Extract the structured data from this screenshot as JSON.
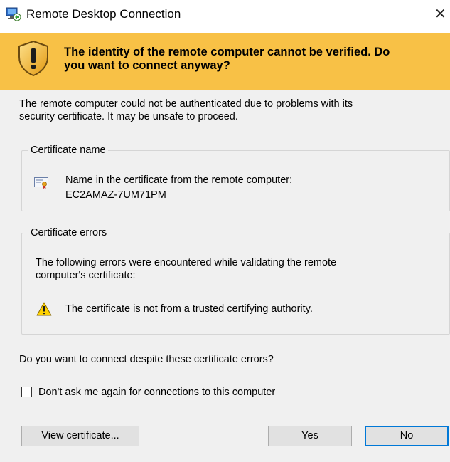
{
  "window": {
    "title": "Remote Desktop Connection",
    "close_glyph": "✕",
    "app_icon": "remote-desktop-icon"
  },
  "banner": {
    "icon": "shield-warning-icon",
    "heading": "The identity of the remote computer cannot be verified. Do you want to connect anyway?",
    "line1": "The identity of the remote computer cannot be verified. Do",
    "line2": "you want to connect anyway?",
    "background": "#f8c146"
  },
  "intro": {
    "line1": "The remote computer could not be authenticated due to problems with its",
    "line2": "security certificate. It may be unsafe to proceed."
  },
  "certificate_name": {
    "legend": "Certificate name",
    "icon": "certificate-icon",
    "label": "Name in the certificate from the remote computer:",
    "value": "EC2AMAZ-7UM71PM"
  },
  "certificate_errors": {
    "legend": "Certificate errors",
    "intro_line1": "The following errors were encountered while validating the remote",
    "intro_line2": "computer's certificate:",
    "items": [
      {
        "icon": "warning-icon",
        "text": "The certificate is not from a trusted certifying authority."
      }
    ]
  },
  "question": "Do you want to connect despite these certificate errors?",
  "dont_ask": {
    "label": "Don't ask me again for connections to this computer",
    "checked": false
  },
  "buttons": {
    "view_certificate": "View certificate...",
    "yes": "Yes",
    "no": "No"
  },
  "colors": {
    "focus_border": "#0078d7",
    "content_bg": "#f0f0f0"
  }
}
